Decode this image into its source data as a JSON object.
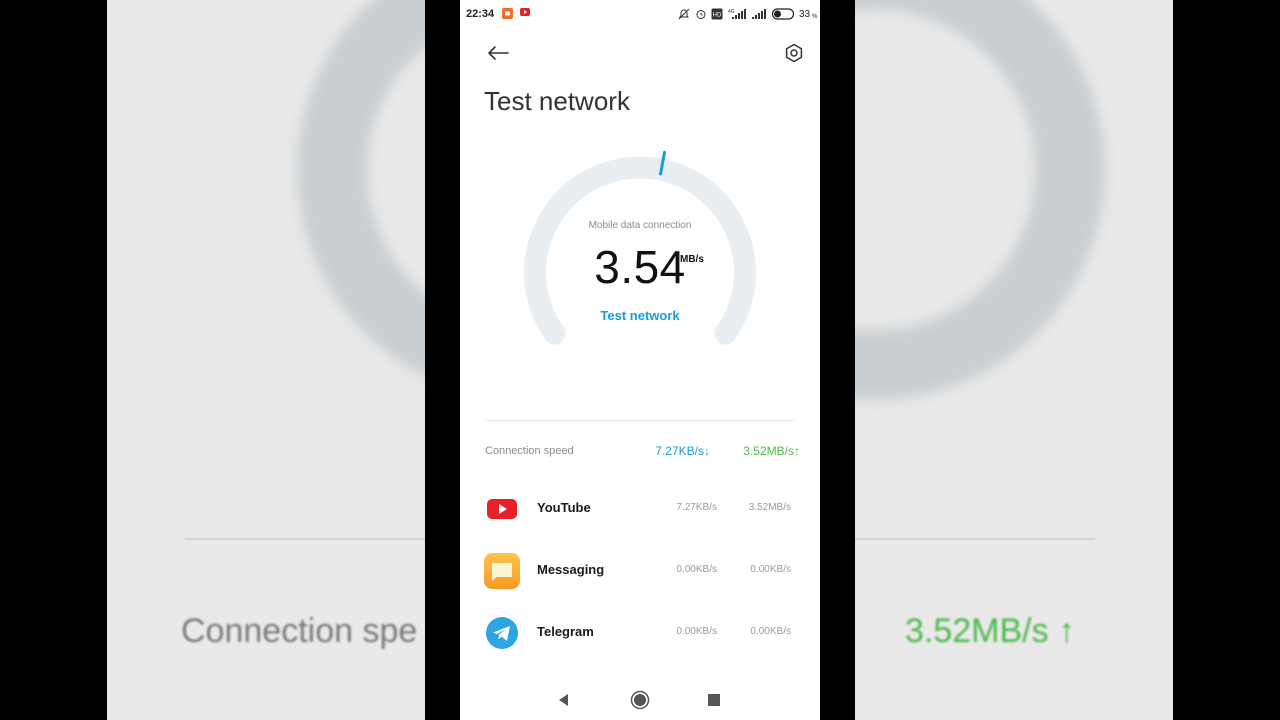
{
  "background": {
    "left_text": "Connection spe",
    "right_text": "3.52MB/s ↑",
    "colors": {
      "side": "#e9e9e9",
      "arc": "#c9ced2",
      "up": "#4cb84c"
    }
  },
  "status_bar": {
    "time": "22:34",
    "battery": "33",
    "icons": [
      "screen-record-icon",
      "youtube-notification-icon",
      "mute-icon",
      "alarm-icon",
      "volte-icon",
      "signal-4g-icon",
      "signal-icon",
      "battery-icon"
    ]
  },
  "header": {
    "title": "Test network",
    "back_icon": "back-arrow-icon",
    "settings_icon": "settings-hexagon-icon"
  },
  "gauge": {
    "label": "Mobile data connection",
    "speed": "3.54",
    "unit": "MB/s",
    "link": "Test network",
    "colors": {
      "track": "#e8eef2",
      "needle": "#1a9be0"
    }
  },
  "connection": {
    "label": "Connection speed",
    "down": "7.27KB/s↓",
    "up": "3.52MB/s↑",
    "colors": {
      "down": "#1a9be0",
      "up": "#4cb84c"
    }
  },
  "apps": [
    {
      "name": "YouTube",
      "down": "7.27KB/s",
      "up": "3.52MB/s",
      "icon": "youtube-icon"
    },
    {
      "name": "Messaging",
      "down": "0.00KB/s",
      "up": "0.00KB/s",
      "icon": "messaging-icon"
    },
    {
      "name": "Telegram",
      "down": "0.00KB/s",
      "up": "0.00KB/s",
      "icon": "telegram-icon"
    }
  ],
  "nav": {
    "buttons": [
      "back-triangle-icon",
      "home-circle-icon",
      "recents-square-icon"
    ]
  }
}
